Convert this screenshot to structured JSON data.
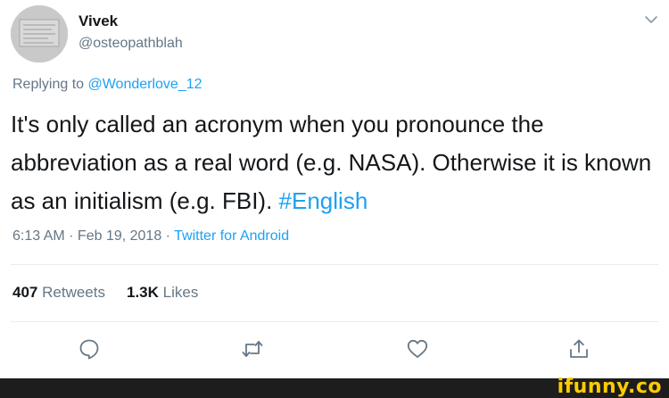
{
  "author": {
    "name": "Vivek",
    "handle": "@osteopathblah"
  },
  "reply": {
    "prefix": "Replying to ",
    "mention": "@Wonderlove_12"
  },
  "tweet": {
    "text": "It's only called an acronym when you pronounce the abbreviation as a real word (e.g. NASA). Otherwise it is known as an initialism (e.g. FBI). ",
    "hashtag": "#English"
  },
  "meta": {
    "time": "6:13 AM",
    "separator": " · ",
    "date": "Feb 19, 2018",
    "source": "Twitter for Android"
  },
  "stats": {
    "retweets_count": "407",
    "retweets_label": "Retweets",
    "likes_count": "1.3K",
    "likes_label": "Likes"
  },
  "icons": {
    "caret": "chevron-down-icon",
    "reply": "reply-icon",
    "retweet": "retweet-icon",
    "like": "heart-icon",
    "share": "share-icon"
  },
  "watermark": {
    "text": "ifunny.co"
  },
  "colors": {
    "link": "#1da1f2",
    "text": "#14171a",
    "muted": "#657786",
    "watermark": "#ffcc00"
  }
}
